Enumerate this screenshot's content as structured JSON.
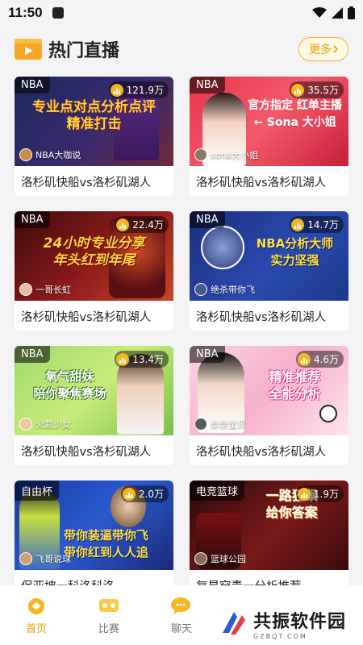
{
  "status_bar": {
    "time": "11:50"
  },
  "header": {
    "title": "热门直播",
    "more_label": "更多"
  },
  "cards": [
    {
      "category": "NBA",
      "views": "121.9万",
      "anchor": "NBA大咖说",
      "banner": "专业点对点分析点评\n精准打击",
      "title": "洛杉矶快船vs洛杉矶湖人"
    },
    {
      "category": "NBA",
      "views": "35.5万",
      "anchor": "sona大小姐",
      "banner": "官方指定 红单主播\n← Sona 大小姐",
      "title": "洛杉矶快船vs洛杉矶湖人"
    },
    {
      "category": "NBA",
      "views": "22.4万",
      "anchor": "一哥长虹",
      "banner": "24小时专业分享\n年头红到年尾",
      "title": "洛杉矶快船vs洛杉矶湖人"
    },
    {
      "category": "NBA",
      "views": "14.7万",
      "anchor": "绝杀带你飞",
      "banner": "NBA分析大师\n实力坚强",
      "title": "洛杉矶快船vs洛杉矶湖人"
    },
    {
      "category": "NBA",
      "views": "13.4万",
      "anchor": "火箭少女",
      "banner": "氧气甜妹\n陪你聚焦赛场",
      "title": "洛杉矶快船vs洛杉矶湖人"
    },
    {
      "category": "NBA",
      "views": "4.6万",
      "anchor": "奈奈宝贝",
      "banner": "精准推荐\n全能分析",
      "title": "洛杉矶快船vs洛杉矶湖人"
    },
    {
      "category": "自由杯",
      "views": "2.0万",
      "anchor": "飞哥说球",
      "banner": "带你装逼带你飞\n带你红到人人追",
      "title": "保亚坡一科洛科洛"
    },
    {
      "category": "电竞篮球",
      "views": "1.9万",
      "anchor": "篮球公园",
      "banner": "一路狂飙\n给你答案",
      "title": "复星穿青一分析推荐"
    }
  ],
  "tabbar": {
    "items": [
      {
        "label": "首页",
        "icon": "home-icon"
      },
      {
        "label": "比赛",
        "icon": "match-icon"
      },
      {
        "label": "聊天",
        "icon": "chat-icon"
      },
      {
        "label": "",
        "icon": "news-icon"
      },
      {
        "label": "",
        "icon": "profile-icon"
      }
    ]
  },
  "watermark": {
    "title": "共振软件园",
    "url": "GZBQT.COM"
  },
  "colors": {
    "accent": "#e7a200",
    "background": "#f3f3f5"
  }
}
